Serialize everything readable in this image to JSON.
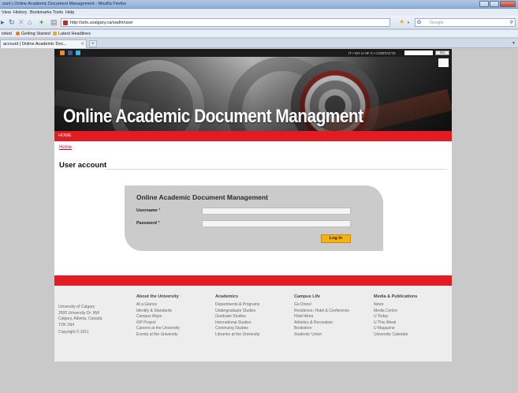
{
  "browser": {
    "window_title": "ount | Online Academic Document Management - Mozilla Firefox",
    "menu": [
      "View",
      "History",
      "Bookmarks",
      "Tools",
      "Help"
    ],
    "url": "http://arts.ucalgary.ca/oadm/user",
    "search_placeholder": "Google",
    "search_engine_label": "G",
    "bookmarks": [
      "isited",
      "Getting Started",
      "Latest Headlines"
    ],
    "tab_title": "account | Online Academic Doc...",
    "new_tab_label": "+"
  },
  "site": {
    "top_links": "IT • MY U OF C • CONTACTS",
    "go_label": "Go",
    "banner_title": "Online Academic Document Managment",
    "nav_home": "HOME",
    "breadcrumb": "Home",
    "page_title": "User account"
  },
  "login": {
    "heading": "Online Academic Document Management",
    "username_label": "Username",
    "password_label": "Password",
    "required_mark": "*",
    "submit_label": "Log in"
  },
  "footer": {
    "address": [
      "University of Calgary",
      "2500 University Dr. NW",
      "Calgary, Alberta, Canada",
      "T2N 1N4",
      "Copyright © 2011"
    ],
    "columns": [
      {
        "heading": "About the University",
        "links": [
          "At a Glance",
          "Identity & Standards",
          "Campus Maps",
          "iSP Project",
          "Careers at the University",
          "Events at the University"
        ]
      },
      {
        "heading": "Academics",
        "links": [
          "Departments & Programs",
          "Undergraduate Studies",
          "Graduate Studies",
          "International Studies",
          "Continuing Studies",
          "Libraries at the University"
        ]
      },
      {
        "heading": "Campus Life",
        "links": [
          "Go Dinos!",
          "Residence, Hotel & Conference",
          "Hotel Alma",
          "Athletics & Recreation",
          "Bookstore",
          "Students' Union"
        ]
      },
      {
        "heading": "Media & Publications",
        "links": [
          "News",
          "Media Centre",
          "U Today",
          "U This Week",
          "U Magazine",
          "University Calendar"
        ]
      }
    ]
  },
  "colors": {
    "accent_red": "#e31c24",
    "button_gold": "#f5b20f",
    "social_rss": "#f08a24",
    "social_facebook": "#3b5998",
    "social_twitter": "#33b5e5"
  }
}
